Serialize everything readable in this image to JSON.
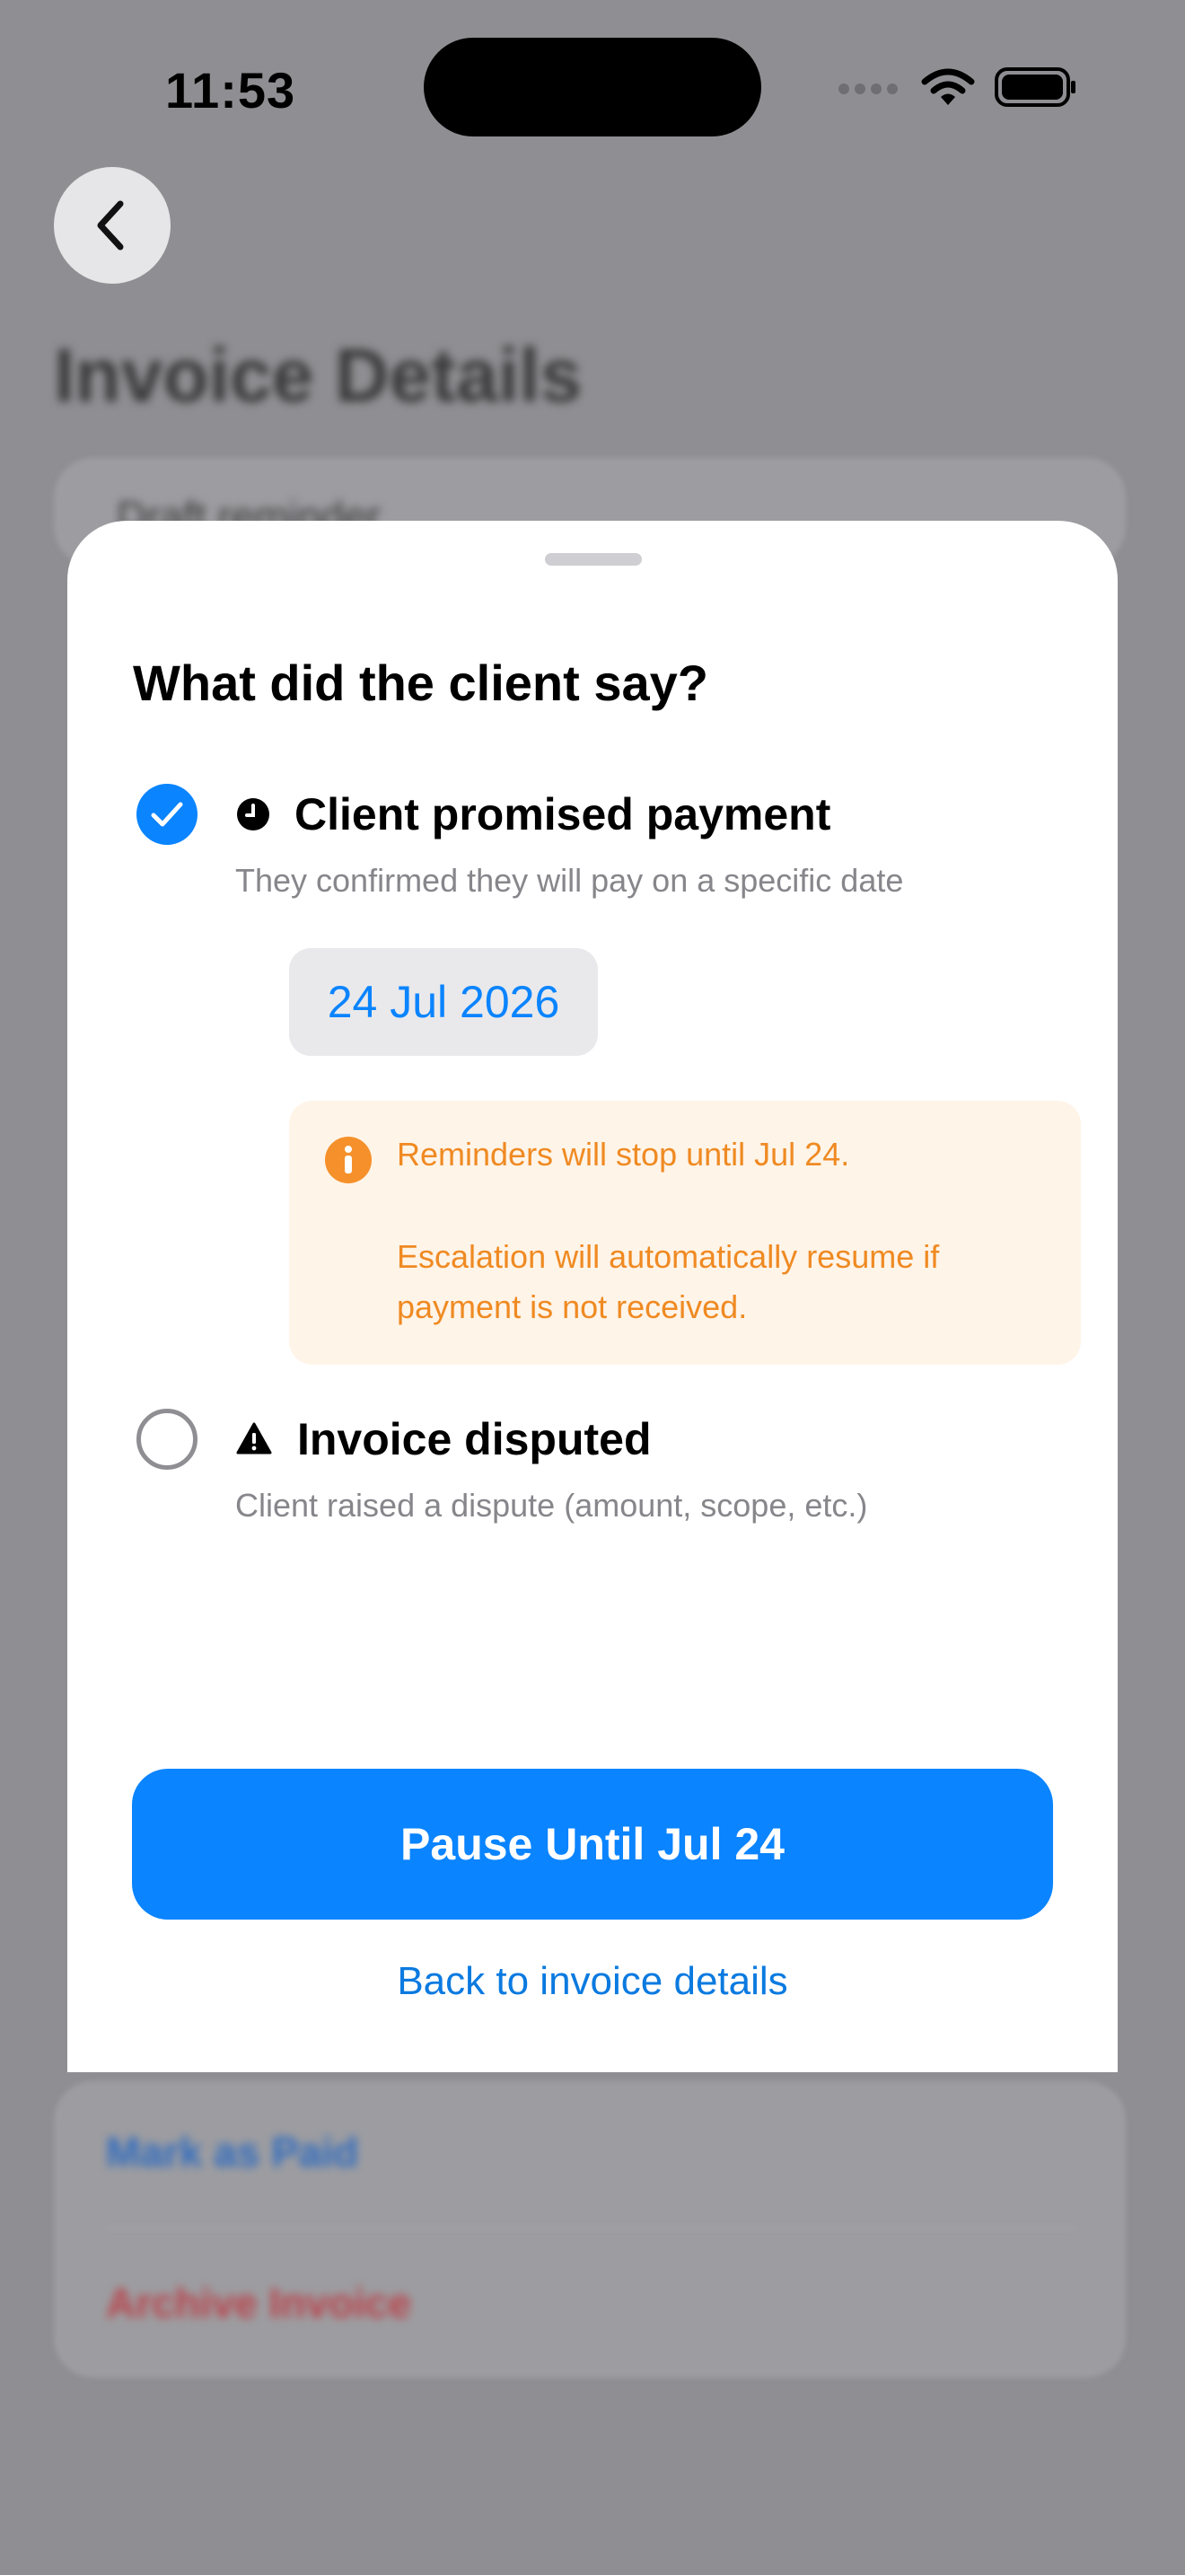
{
  "status_bar": {
    "time": "11:53"
  },
  "background": {
    "title": "Invoice Details",
    "peek_text": "Draft reminder",
    "mark_paid": "Mark as Paid",
    "archive": "Archive Invoice"
  },
  "sheet": {
    "title": "What did the client say?",
    "options": [
      {
        "title": "Client promised payment",
        "subtitle": "They confirmed they will pay on a specific date",
        "selected": true,
        "icon": "clock-icon"
      },
      {
        "title": "Invoice disputed",
        "subtitle": "Client raised a dispute (amount, scope, etc.)",
        "selected": false,
        "icon": "warning-icon"
      }
    ],
    "date_value": "24 Jul 2026",
    "info": {
      "line1": "Reminders will stop until Jul 24.",
      "line2": "Escalation will automatically resume if",
      "line3": "payment is not received."
    },
    "primary_button": "Pause Until Jul 24",
    "secondary_link": "Back to invoice details"
  },
  "colors": {
    "accent": "#0a84ff",
    "warning_bg": "#fff4e8",
    "warning_text": "#ef8a22"
  }
}
